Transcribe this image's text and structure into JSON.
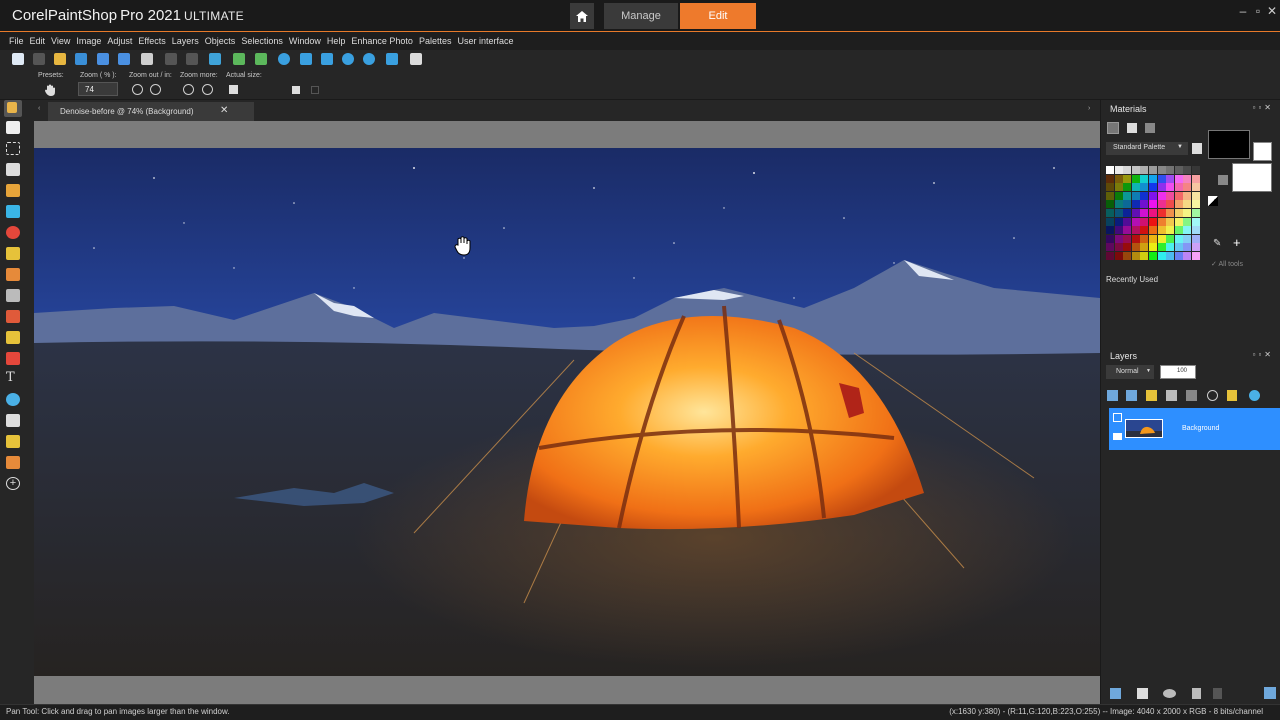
{
  "app": {
    "title_brand": "Corel",
    "title_product": "PaintShop",
    "title_pro": "Pro 2021",
    "title_edition": "ULTIMATE",
    "tabs": {
      "manage": "Manage",
      "edit": "Edit"
    },
    "accent_color": "#ee7a2c"
  },
  "menu": [
    "File",
    "Edit",
    "View",
    "Image",
    "Adjust",
    "Effects",
    "Layers",
    "Objects",
    "Selections",
    "Window",
    "Help",
    "Enhance Photo",
    "Palettes",
    "User interface"
  ],
  "options": {
    "presets_label": "Presets:",
    "zoom_label": "Zoom ( % ):",
    "zoom_value": "74",
    "zoom_inout_label": "Zoom out / in:",
    "zoom_more_label": "Zoom more:",
    "actual_size_label": "Actual size:"
  },
  "document": {
    "tab_title": "Denoise-before @  74% (Background)",
    "close_glyph": "✕"
  },
  "materials": {
    "title": "Materials",
    "palette_select": "Standard Palette",
    "all_tools": "All tools",
    "recently_used": "Recently Used"
  },
  "layers": {
    "title": "Layers",
    "blend_mode": "Normal",
    "opacity": "100",
    "layer_name": "Background"
  },
  "status": {
    "tool_hint": "Pan Tool: Click and drag to pan images larger than the window.",
    "info": "(x:1630 y:380) - (R:11,G:120,B:223,O:255) -- Image:  4040 x 2000 x RGB - 8 bits/channel"
  }
}
